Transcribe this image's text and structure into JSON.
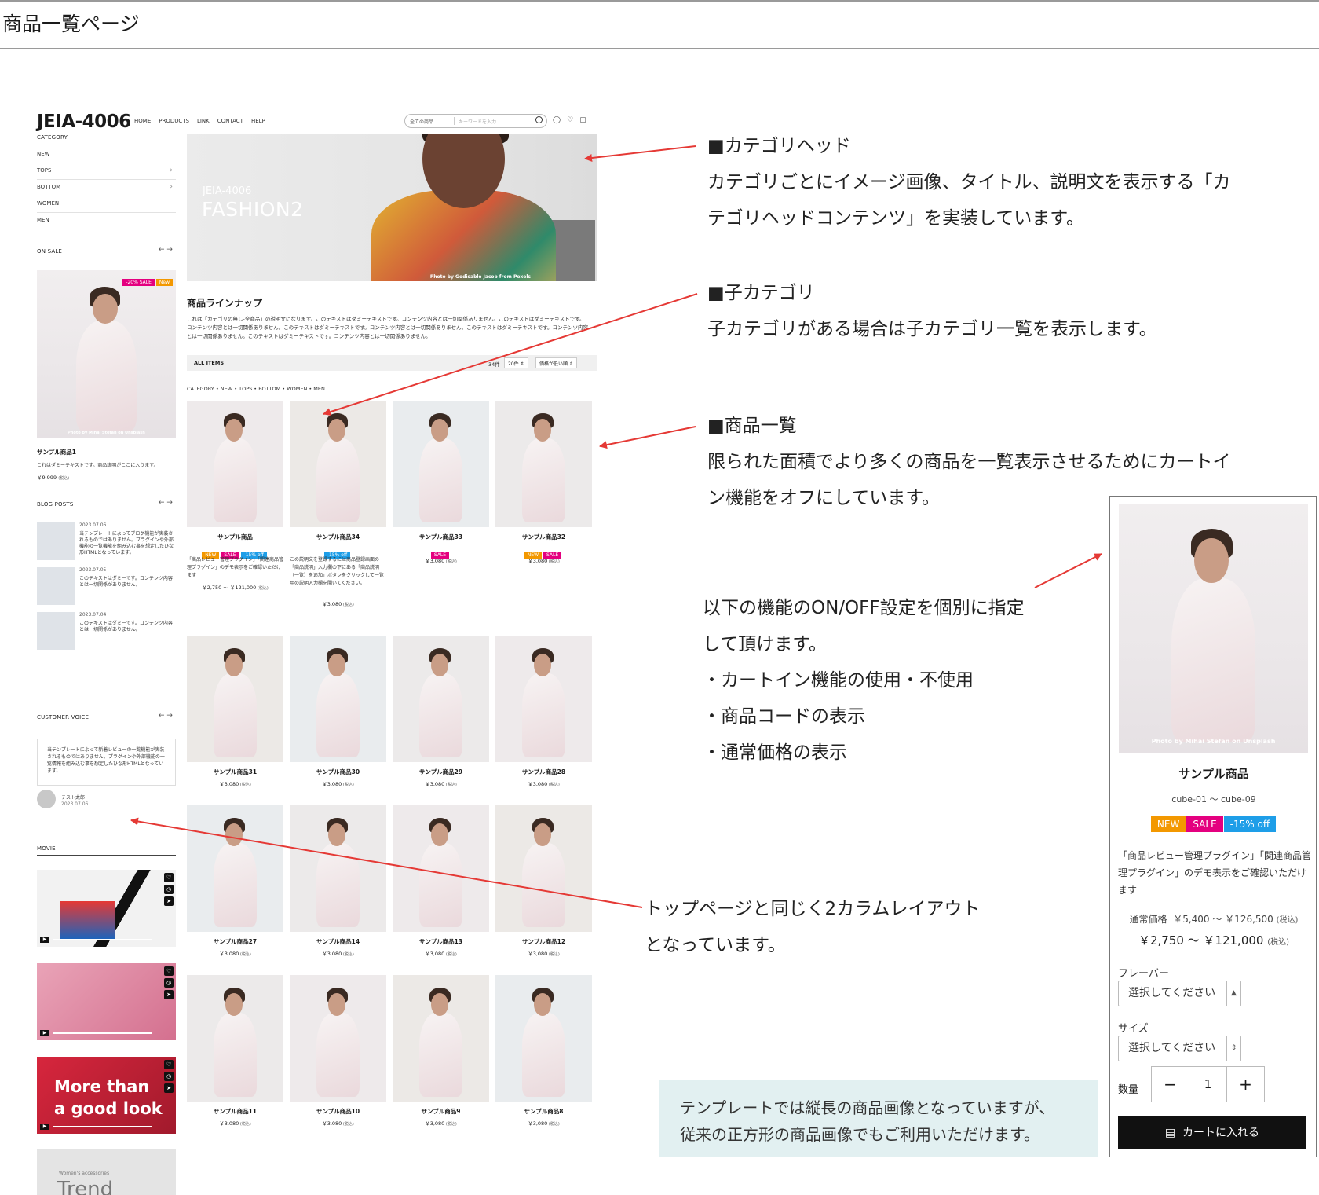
{
  "page": {
    "title": "商品一覧ページ"
  },
  "store": {
    "logo": "JEIA-4006",
    "nav": [
      "HOME",
      "PRODUCTS",
      "LINK",
      "CONTACT",
      "HELP"
    ],
    "search": {
      "scope": "全ての商品",
      "placeholder": "キーワードを入力"
    },
    "sidebar": {
      "category_title": "CATEGORY",
      "categories": [
        "NEW",
        "TOPS",
        "BOTTOM",
        "WOMEN",
        "MEN"
      ],
      "on_sale_title": "ON SALE",
      "on_sale_item": {
        "badges": [
          "-20% SALE",
          "New"
        ],
        "credit": "Photo by Mihai Stefan on Unsplash",
        "name": "サンプル商品1",
        "desc": "これはダミーテキストです。商品説明がここに入ります。",
        "price": "￥9,999",
        "tax": "(税込)"
      },
      "blog_title": "BLOG POSTS",
      "blog_posts": [
        {
          "date": "2023.07.06",
          "text": "当テンプレートによってブログ機能が実装されるものではありません。ブラグインや外部機能の一覧機能を組み込む事を想定したひな形HTMLとなっています。"
        },
        {
          "date": "2023.07.05",
          "text": "このテキストはダミーです。コンテンツ内容とは一切関係がありません。"
        },
        {
          "date": "2023.07.04",
          "text": "このテキストはダミーです。コンテンツ内容とは一切関係がありません。"
        }
      ],
      "voice_title": "CUSTOMER VOICE",
      "voice_text": "当テンプレートによって新着レビューの一覧機能が実装されるものではありません。プラグインや外部機能の一覧情報を組み込む事を想定したひな形HTMLとなっています。",
      "voice_name": "テスト太郎",
      "voice_date": "2023.07.06",
      "movie_title": "MOVIE",
      "movie_text": [
        "More than",
        "a good look"
      ],
      "last_banner": {
        "small": "Women's accessories",
        "big": "Trend"
      }
    },
    "hero": {
      "sub": "JEIA-4006",
      "main": "FASHION2",
      "credit": "Photo by Godisable Jacob from Pexels"
    },
    "lineup": {
      "title": "商品ラインナップ",
      "desc": "これは「カテゴリの無し-全商品」の説明文になります。このテキストはダミーテキストです。コンテンツ内容とは一切関係ありません。このテキストはダミーテキストです。コンテンツ内容とは一切関係ありません。このテキストはダミーテキストです。コンテンツ内容とは一切関係ありません。このテキストはダミーテキストです。コンテンツ内容とは一切関係ありません。このテキストはダミーテキストです。コンテンツ内容とは一切関係ありません。"
    },
    "toolbar": {
      "label": "ALL ITEMS",
      "count": "34件",
      "per_page": "20件",
      "sort": "価格が低い順"
    },
    "child_categories": "CATEGORY • NEW • TOPS • BOTTOM • WOMEN • MEN",
    "products": [
      {
        "name": "サンプル商品",
        "badges": [
          "NEW",
          "SALE",
          "-15% off"
        ],
        "desc": "「商品レビュー管理プラグイン」「関連商品管理プラグイン」のデモ表示をご確認いただけます",
        "price": "￥2,750 ～ ￥121,000",
        "tax": "(税込)"
      },
      {
        "name": "サンプル商品34",
        "badges": [
          "-15% off"
        ],
        "desc": "この説明文を登録するには商品登録画面の「商品説明」入力欄の下にある「商品説明（一覧）を追加」ボタンをクリックして一覧用の説明入力欄を開いてください。",
        "price": "￥3,080",
        "tax": "(税込)"
      },
      {
        "name": "サンプル商品33",
        "badges": [
          "SALE"
        ],
        "desc": "",
        "price": "￥3,080",
        "tax": "(税込)"
      },
      {
        "name": "サンプル商品32",
        "badges": [
          "NEW",
          "SALE"
        ],
        "desc": "",
        "price": "￥3,080",
        "tax": "(税込)"
      },
      {
        "name": "サンプル商品31",
        "badges": [],
        "desc": "",
        "price": "￥3,080",
        "tax": "(税込)"
      },
      {
        "name": "サンプル商品30",
        "badges": [],
        "desc": "",
        "price": "￥3,080",
        "tax": "(税込)"
      },
      {
        "name": "サンプル商品29",
        "badges": [],
        "desc": "",
        "price": "￥3,080",
        "tax": "(税込)"
      },
      {
        "name": "サンプル商品28",
        "badges": [],
        "desc": "",
        "price": "￥3,080",
        "tax": "(税込)"
      },
      {
        "name": "サンプル商品27",
        "badges": [],
        "desc": "",
        "price": "￥3,080",
        "tax": "(税込)"
      },
      {
        "name": "サンプル商品14",
        "badges": [],
        "desc": "",
        "price": "￥3,080",
        "tax": "(税込)"
      },
      {
        "name": "サンプル商品13",
        "badges": [],
        "desc": "",
        "price": "￥3,080",
        "tax": "(税込)"
      },
      {
        "name": "サンプル商品12",
        "badges": [],
        "desc": "",
        "price": "￥3,080",
        "tax": "(税込)"
      },
      {
        "name": "サンプル商品11",
        "badges": [],
        "desc": "",
        "price": "￥3,080",
        "tax": "(税込)"
      },
      {
        "name": "サンプル商品10",
        "badges": [],
        "desc": "",
        "price": "￥3,080",
        "tax": "(税込)"
      },
      {
        "name": "サンプル商品9",
        "badges": [],
        "desc": "",
        "price": "￥3,080",
        "tax": "(税込)"
      },
      {
        "name": "サンプル商品8",
        "badges": [],
        "desc": "",
        "price": "￥3,080",
        "tax": "(税込)"
      }
    ]
  },
  "notes": {
    "category_head": {
      "title": "■カテゴリヘッド",
      "lines": [
        "カテゴリごとにイメージ画像、タイトル、説明文を表示する「カ",
        "テゴリヘッドコンテンツ」を実装しています。"
      ]
    },
    "child_category": {
      "title": "■子カテゴリ",
      "lines": [
        "子カテゴリがある場合は子カテゴリ一覧を表示します。"
      ]
    },
    "product_list": {
      "title": "■商品一覧",
      "lines": [
        "限られた面積でより多くの商品を一覧表示させるためにカートイ",
        "ン機能をオフにしています。"
      ]
    },
    "settings": {
      "lines": [
        "以下の機能のON/OFF設定を個別に指定",
        "して頂けます。",
        "・カートイン機能の使用・不使用",
        "・商品コードの表示",
        "・通常価格の表示"
      ]
    },
    "layout": {
      "lines": [
        "トップページと同じく2カラムレイアウト",
        "となっています。"
      ]
    },
    "image_info": {
      "lines": [
        "テンプレートでは縦長の商品画像となっていますが、",
        "従来の正方形の商品画像でもご利用いただけます。"
      ]
    }
  },
  "detail": {
    "credit": "Photo by Mihai Stefan on Unsplash",
    "name": "サンプル商品",
    "code": "cube-01 ～ cube-09",
    "badges": [
      "NEW",
      "SALE",
      "-15% off"
    ],
    "desc": "「商品レビュー管理プラグイン」「関連商品管理プラグイン」のデモ表示をご確認いただけます",
    "regular_label": "通常価格",
    "regular_price": "￥5,400 ～ ￥126,500",
    "sale_price": "￥2,750 ～ ￥121,000",
    "tax": "(税込)",
    "flavor_label": "フレーバー",
    "size_label": "サイズ",
    "select_placeholder": "選択してください",
    "qty_label": "数量",
    "qty": "1",
    "cart_label": "カートに入れる"
  },
  "colors": {
    "new": "#f39800",
    "sale": "#e4007f",
    "off": "#1e9ee8",
    "arrow": "#e53935",
    "info_bg": "#e2f0f1"
  }
}
